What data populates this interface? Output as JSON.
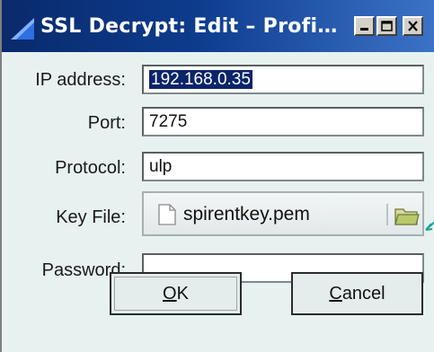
{
  "window": {
    "title": "SSL Decrypt: Edit – Profi…",
    "controls": {
      "minimize": "_",
      "restore": "□",
      "close": "X"
    }
  },
  "form": {
    "ip_label": "IP address:",
    "ip_value": "192.168.0.35",
    "port_label": "Port:",
    "port_value": "7275",
    "protocol_label": "Protocol:",
    "protocol_value": "ulp",
    "keyfile_label": "Key File:",
    "keyfile_value": "spirentkey.pem",
    "password_label": "Password:",
    "password_value": ""
  },
  "buttons": {
    "ok_mnemonic": "O",
    "ok_rest": "K",
    "cancel_mnemonic": "C",
    "cancel_rest": "ancel"
  },
  "colors": {
    "title_start": "#0a2a6b",
    "title_end": "#3c73c6",
    "selection": "#0b246a",
    "dialog_bg": "#e6f1f0"
  },
  "icons": [
    "app-shark-fin-icon",
    "document-icon",
    "folder-open-icon",
    "pointer-arrow-icon"
  ]
}
